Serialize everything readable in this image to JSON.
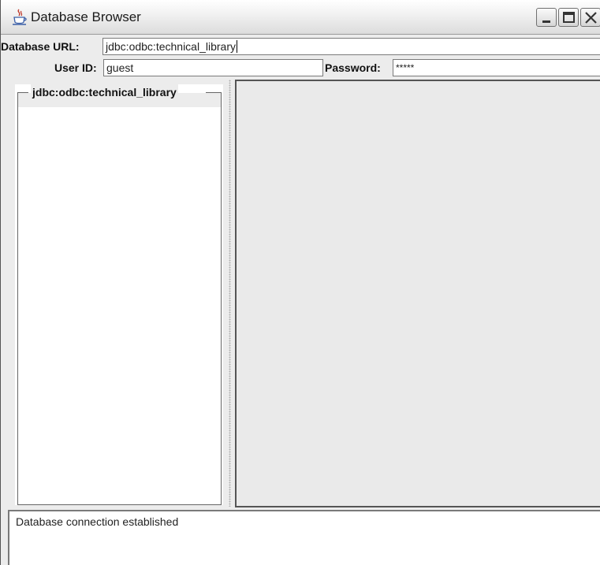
{
  "window": {
    "title": "Database Browser",
    "icon": "java-cup-icon",
    "controls": [
      "minimize-icon",
      "maximize-icon",
      "close-icon"
    ]
  },
  "form": {
    "url_label": "Database URL:",
    "url_value": "jdbc:odbc:technical_library",
    "user_label": "User ID:",
    "user_value": "guest",
    "password_label": "Password:",
    "password_value": "*****"
  },
  "tree": {
    "title": "jdbc:odbc:technical_library"
  },
  "status": {
    "message": "Database connection established"
  }
}
